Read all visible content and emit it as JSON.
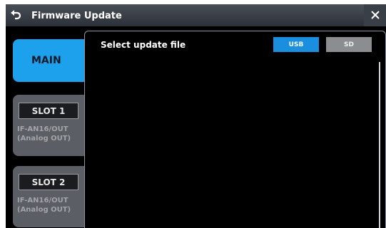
{
  "header": {
    "title": "Firmware Update",
    "back_icon": "back-arrow-icon",
    "close_icon": "close-icon"
  },
  "sidebar": {
    "main_label": "MAIN",
    "slots": [
      {
        "label": "SLOT 1",
        "desc_line1": "IF-AN16/OUT",
        "desc_line2": "(Analog OUT)"
      },
      {
        "label": "SLOT 2",
        "desc_line1": "IF-AN16/OUT",
        "desc_line2": "(Analog OUT)"
      }
    ]
  },
  "panel": {
    "title": "Select update file",
    "sources": [
      {
        "label": "USB",
        "selected": true
      },
      {
        "label": "SD",
        "selected": false
      }
    ],
    "files": []
  },
  "colors": {
    "accent": "#1ea1ec",
    "selected_source": "#1a8fe0",
    "unselected_source": "#8b8d91",
    "slot_card": "#5b5e64"
  }
}
